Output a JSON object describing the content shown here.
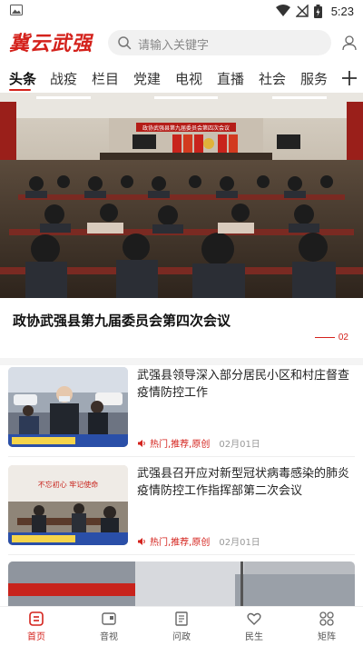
{
  "status_bar": {
    "time": "5:23"
  },
  "header": {
    "logo": "冀云武强",
    "search_placeholder": "请输入关键字"
  },
  "tabs": [
    {
      "label": "头条",
      "active": true
    },
    {
      "label": "战疫"
    },
    {
      "label": "栏目"
    },
    {
      "label": "党建"
    },
    {
      "label": "电视"
    },
    {
      "label": "直播"
    },
    {
      "label": "社会"
    },
    {
      "label": "服务"
    }
  ],
  "hero": {
    "banner_text": "政协武强县第九届委员会第四次会议",
    "title": "政协武强县第九届委员会第四次会议",
    "page_indicator": "02"
  },
  "news": [
    {
      "title": "武强县领导深入部分居民小区和村庄督查疫情防控工作",
      "tags": "热门,推荐,原创",
      "date": "02月01日"
    },
    {
      "title": "武强县召开应对新型冠状病毒感染的肺炎疫情防控工作指挥部第二次会议",
      "tags": "热门,推荐,原创",
      "date": "02月01日",
      "banner": "不忘初心  牢记使命"
    }
  ],
  "bottom_nav": [
    {
      "label": "首页",
      "icon": "home-icon",
      "active": true
    },
    {
      "label": "音视",
      "icon": "video-icon"
    },
    {
      "label": "问政",
      "icon": "inquiry-icon"
    },
    {
      "label": "民生",
      "icon": "heart-icon"
    },
    {
      "label": "矩阵",
      "icon": "matrix-icon"
    }
  ],
  "colors": {
    "accent": "#d4221c",
    "text": "#222222",
    "muted": "#999999"
  }
}
